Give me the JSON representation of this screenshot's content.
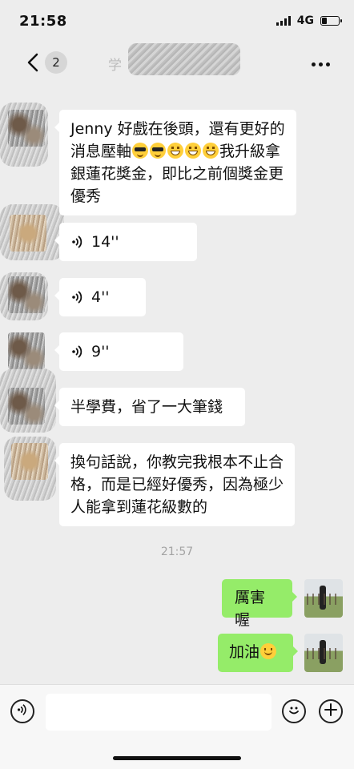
{
  "status_bar": {
    "time": "21:58",
    "network": "4G",
    "battery_level": 0.3
  },
  "header": {
    "back_count": "2",
    "title": "学"
  },
  "messages": [
    {
      "side": "left",
      "type": "text",
      "text_start": "Jenny 好戲在後頭，還有更好的消息壓軸",
      "emojis": [
        "cool",
        "cool",
        "grin",
        "grin",
        "grin"
      ],
      "text_end": "我升級拿銀蓮花獎金，即比之前個獎金更優秀"
    },
    {
      "side": "left",
      "type": "voice",
      "duration": "14''"
    },
    {
      "side": "left",
      "type": "voice",
      "duration": "4''"
    },
    {
      "side": "left",
      "type": "voice",
      "duration": "9''"
    },
    {
      "side": "left",
      "type": "text",
      "text": "半學費，省了一大筆錢"
    },
    {
      "side": "left",
      "type": "text",
      "text": "換句話說，你教完我根本不止合格，而是已經好優秀，因為極少人能拿到蓮花級數的"
    },
    {
      "type": "time",
      "text": "21:57"
    },
    {
      "side": "right",
      "type": "text",
      "text": "厲害喔"
    },
    {
      "side": "right",
      "type": "text",
      "text": "加油",
      "emojis": [
        "smile"
      ]
    }
  ],
  "input": {
    "value": "",
    "placeholder": ""
  },
  "icons": {
    "back": "chevron-left-icon",
    "more": "more-icon",
    "voice": "voice-icon",
    "emoji": "emoji-icon",
    "add": "plus-icon"
  },
  "colors": {
    "background": "#ededed",
    "bubble_left": "#ffffff",
    "bubble_right": "#95ec69"
  }
}
